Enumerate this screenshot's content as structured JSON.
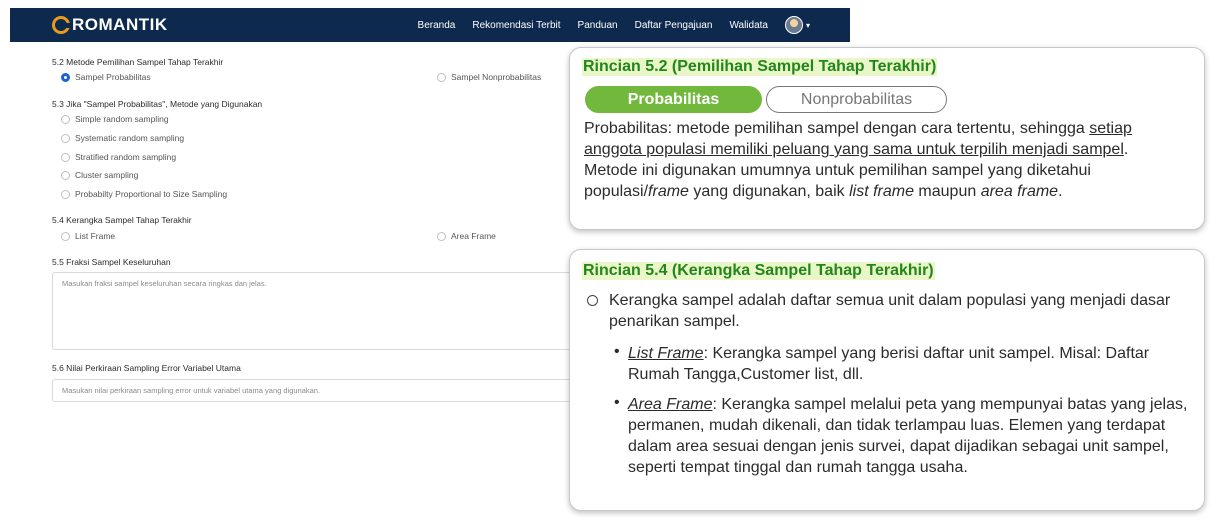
{
  "navbar": {
    "brand": "ROMANTIK",
    "links": [
      "Beranda",
      "Rekomendasi Terbit",
      "Panduan",
      "Daftar Pengajuan",
      "Walidata"
    ]
  },
  "form": {
    "q52": {
      "label": "5.2 Metode Pemilihan Sampel Tahap Terakhir",
      "opt1": "Sampel Probabilitas",
      "opt2": "Sampel Nonprobabilitas"
    },
    "q53": {
      "label": "5.3 Jika \"Sampel Probabilitas\", Metode yang Digunakan",
      "options": [
        "Simple random sampling",
        "Systematic random sampling",
        "Stratified random sampling",
        "Cluster sampling",
        "Probabilty Proportional to Size Sampling"
      ]
    },
    "q54": {
      "label": "5.4 Kerangka Sampel Tahap Terakhir",
      "opt1": "List Frame",
      "opt2": "Area Frame"
    },
    "q55": {
      "label": "5.5 Fraksi Sampel Keseluruhan",
      "placeholder": "Masukan fraksi sampel keseluruhan secara ringkas dan jelas."
    },
    "q56": {
      "label": "5.6 Nilai Perkiraan Sampling Error Variabel Utama",
      "placeholder": "Masukan nilai perkiraan sampling error untuk variabel utama yang digunakan."
    }
  },
  "callout1": {
    "title": "Rincian 5.2 (Pemilihan Sampel Tahap Terakhir)",
    "pill_active": "Probabilitas",
    "pill_inactive": "Nonprobabilitas",
    "text_a": "Probabilitas: metode pemilihan sampel dengan cara tertentu, sehingga ",
    "text_u": "setiap anggota populasi memiliki peluang yang sama untuk terpilih menjadi sampel",
    "text_b": ". Metode ini digunakan umumnya untuk pemilihan sampel yang diketahui populasi/",
    "text_i1": "frame",
    "text_c": " yang digunakan, baik ",
    "text_i2": "list frame",
    "text_d": " maupun ",
    "text_i3": "area frame",
    "text_e": "."
  },
  "callout2": {
    "title": "Rincian 5.4 (Kerangka Sampel Tahap Terakhir)",
    "intro": "Kerangka sampel adalah daftar semua unit dalam populasi yang menjadi dasar penarikan sampel.",
    "list_term": "List Frame",
    "list_text": ": Kerangka sampel yang berisi daftar unit sampel. Misal: Daftar Rumah Tangga,Customer list, dll.",
    "area_term": "Area Frame",
    "area_text": ": Kerangka sampel melalui peta yang mempunyai batas yang jelas, permanen, mudah dikenali, dan tidak terlampau luas. Elemen yang terdapat dalam area sesuai dengan jenis survei, dapat dijadikan sebagai unit sampel, seperti tempat tinggal dan rumah tangga usaha."
  }
}
